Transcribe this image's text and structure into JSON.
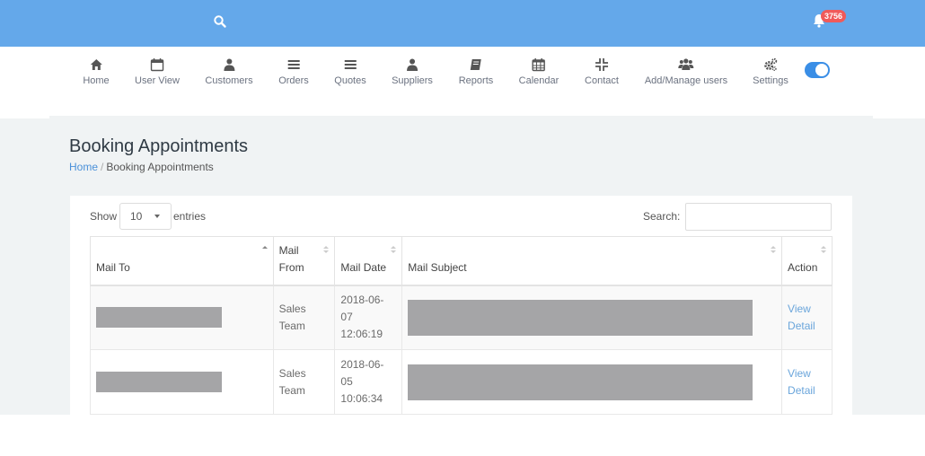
{
  "topbar": {
    "bg_color": "#64a8ea",
    "search_icon": "search-icon",
    "bell_icon": "bell-icon",
    "notification_count": "3756"
  },
  "nav": {
    "items": [
      {
        "label": "Home",
        "icon": "home-icon"
      },
      {
        "label": "User View",
        "icon": "calendar-icon"
      },
      {
        "label": "Customers",
        "icon": "user-icon"
      },
      {
        "label": "Orders",
        "icon": "bars-icon"
      },
      {
        "label": "Quotes",
        "icon": "bars-icon"
      },
      {
        "label": "Suppliers",
        "icon": "user-icon"
      },
      {
        "label": "Reports",
        "icon": "book-icon"
      },
      {
        "label": "Calendar",
        "icon": "calendar-grid-icon"
      },
      {
        "label": "Contact",
        "icon": "compress-icon"
      },
      {
        "label": "Add/Manage users",
        "icon": "users-icon"
      },
      {
        "label": "Settings",
        "icon": "cogs-icon"
      }
    ],
    "toggle_on": true
  },
  "page": {
    "title": "Booking Appointments",
    "breadcrumb": {
      "home": "Home",
      "current": "Booking Appointments"
    }
  },
  "table_controls": {
    "show_label": "Show",
    "page_length": "10",
    "entries_label": "entries",
    "search_label": "Search:",
    "search_value": ""
  },
  "table": {
    "columns": [
      "Mail To",
      "Mail From",
      "Mail Date",
      "Mail Subject",
      "Action"
    ],
    "rows": [
      {
        "mail_from": [
          "Sales",
          "Team"
        ],
        "mail_date": [
          "2018-06-",
          "07",
          "12:06:19"
        ],
        "action": [
          "View",
          "Detail"
        ]
      },
      {
        "mail_from": [
          "Sales",
          "Team"
        ],
        "mail_date": [
          "2018-06-",
          "05",
          "10:06:34"
        ],
        "action": [
          "View",
          "Detail"
        ]
      }
    ]
  }
}
